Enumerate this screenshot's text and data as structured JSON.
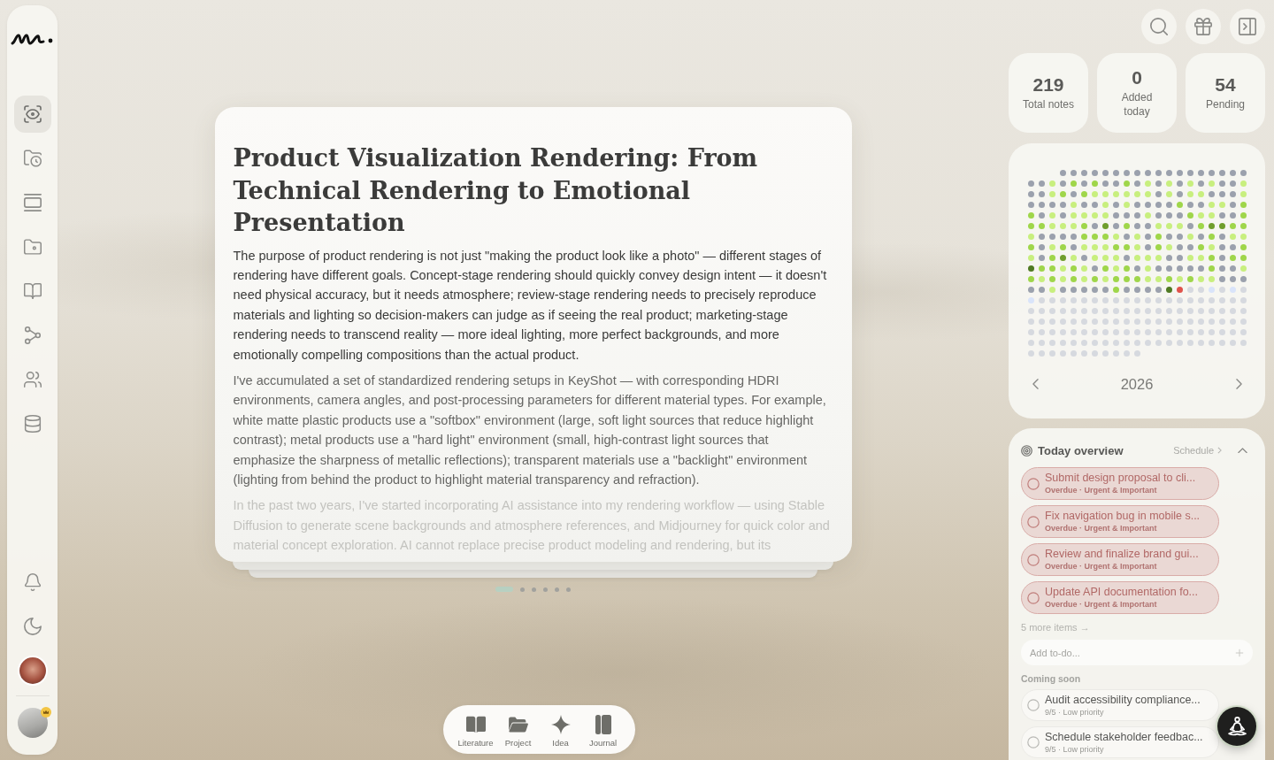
{
  "sidebar": {
    "nav": [
      {
        "selected": true
      },
      {
        "selected": false
      },
      {
        "selected": false
      },
      {
        "selected": false
      },
      {
        "selected": false
      },
      {
        "selected": false
      },
      {
        "selected": false
      },
      {
        "selected": false
      }
    ]
  },
  "article": {
    "title": "Product Visualization Rendering: From Technical Rendering to Emotional Presentation",
    "paragraphs": [
      "The purpose of product rendering is not just \"making the product look like a photo\" — different stages of rendering have different goals. Concept-stage rendering should quickly convey design intent — it doesn't need physical accuracy, but it needs atmosphere; review-stage rendering needs to precisely reproduce materials and lighting so decision-makers can judge as if seeing the real product; marketing-stage rendering needs to transcend reality — more ideal lighting, more perfect backgrounds, and more emotionally compelling compositions than the actual product.",
      "I've accumulated a set of standardized rendering setups in KeyShot — with corresponding HDRI environments, camera angles, and post-processing parameters for different material types. For example, white matte plastic products use a \"softbox\" environment (large, soft light sources that reduce highlight contrast); metal products use a \"hard light\" environment (small, high-contrast light sources that emphasize the sharpness of metallic reflections); transparent materials use a \"backlight\" environment (lighting from behind the product to highlight material transparency and refraction).",
      "In the past two years, I've started incorporating AI assistance into my rendering workflow — using Stable Diffusion to generate scene backgrounds and atmosphere references, and Midjourney for quick color and material concept exploration. AI cannot replace precise product modeling and rendering, but its"
    ]
  },
  "pager": [
    {
      "selected": true
    },
    {
      "selected": false
    },
    {
      "selected": false
    },
    {
      "selected": false
    },
    {
      "selected": false
    },
    {
      "selected": false
    }
  ],
  "toolbar": [
    {
      "label": "Literature"
    },
    {
      "label": "Project"
    },
    {
      "label": "Idea"
    },
    {
      "label": "Journal"
    }
  ],
  "stats": [
    {
      "value": "219",
      "label": "Total notes"
    },
    {
      "value": "0",
      "label": "Added today"
    },
    {
      "value": "54",
      "label": "Pending"
    }
  ],
  "calendar": {
    "days": [
      {
        "color": "#9ba1ad"
      },
      {
        "color": "#9ba1ad"
      },
      {
        "color": "#9ba1ad"
      },
      {
        "color": "#9ba1ad"
      },
      {
        "color": "#9ba1ad"
      },
      {
        "color": "#9ba1ad"
      },
      {
        "color": "#9ba1ad"
      },
      {
        "color": "#9ba1ad"
      },
      {
        "color": "#9ba1ad"
      },
      {
        "color": "#9ba1ad"
      },
      {
        "color": "#9ba1ad"
      },
      {
        "color": "#9ba1ad"
      },
      {
        "color": "#9ba1ad"
      },
      {
        "color": "#9ba1ad"
      },
      {
        "color": "#9ba1ad"
      },
      {
        "color": "#9ba1ad"
      },
      {
        "color": "#9ba1ad"
      },
      {
        "color": "#9ba1ad"
      },
      {
        "color": "#9ba1ad"
      },
      {
        "color": "#9ba1ad"
      },
      {
        "color": "#c8ef7e"
      },
      {
        "color": "#9ba1ad"
      },
      {
        "color": "#9fd64a"
      },
      {
        "color": "#9ba1ad"
      },
      {
        "color": "#9fd64a"
      },
      {
        "color": "#9ba1ad"
      },
      {
        "color": "#9ba1ad"
      },
      {
        "color": "#9fd64a"
      },
      {
        "color": "#9ba1ad"
      },
      {
        "color": "#c8ef7e"
      },
      {
        "color": "#9ba1ad"
      },
      {
        "color": "#c8ef7e"
      },
      {
        "color": "#9ba1ad"
      },
      {
        "color": "#c8ef7e"
      },
      {
        "color": "#9ba1ad"
      },
      {
        "color": "#c8ef7e"
      },
      {
        "color": "#9ba1ad"
      },
      {
        "color": "#9ba1ad"
      },
      {
        "color": "#c8ef7e"
      },
      {
        "color": "#9ba1ad"
      },
      {
        "color": "#9ba1ad"
      },
      {
        "color": "#c8ef7e"
      },
      {
        "color": "#9fd64a"
      },
      {
        "color": "#9ba1ad"
      },
      {
        "color": "#9fd64a"
      },
      {
        "color": "#c8ef7e"
      },
      {
        "color": "#c8ef7e"
      },
      {
        "color": "#c8ef7e"
      },
      {
        "color": "#c8ef7e"
      },
      {
        "color": "#c8ef7e"
      },
      {
        "color": "#c8ef7e"
      },
      {
        "color": "#9ba1ad"
      },
      {
        "color": "#c8ef7e"
      },
      {
        "color": "#9ba1ad"
      },
      {
        "color": "#c8ef7e"
      },
      {
        "color": "#c8ef7e"
      },
      {
        "color": "#9ba1ad"
      },
      {
        "color": "#9ba1ad"
      },
      {
        "color": "#9ba1ad"
      },
      {
        "color": "#c8ef7e"
      },
      {
        "color": "#9ba1ad"
      },
      {
        "color": "#9ba1ad"
      },
      {
        "color": "#9ba1ad"
      },
      {
        "color": "#9ba1ad"
      },
      {
        "color": "#c8ef7e"
      },
      {
        "color": "#9ba1ad"
      },
      {
        "color": "#9ba1ad"
      },
      {
        "color": "#c8ef7e"
      },
      {
        "color": "#9ba1ad"
      },
      {
        "color": "#c8ef7e"
      },
      {
        "color": "#9ba1ad"
      },
      {
        "color": "#9ba1ad"
      },
      {
        "color": "#9ba1ad"
      },
      {
        "color": "#9ba1ad"
      },
      {
        "color": "#9fd64a"
      },
      {
        "color": "#9ba1ad"
      },
      {
        "color": "#9ba1ad"
      },
      {
        "color": "#c8ef7e"
      },
      {
        "color": "#c8ef7e"
      },
      {
        "color": "#9ba1ad"
      },
      {
        "color": "#9fd64a"
      },
      {
        "color": "#9fd64a"
      },
      {
        "color": "#9ba1ad"
      },
      {
        "color": "#c8ef7e"
      },
      {
        "color": "#9ba1ad"
      },
      {
        "color": "#c8ef7e"
      },
      {
        "color": "#c8ef7e"
      },
      {
        "color": "#c8ef7e"
      },
      {
        "color": "#c8ef7e"
      },
      {
        "color": "#9ba1ad"
      },
      {
        "color": "#9ba1ad"
      },
      {
        "color": "#9ba1ad"
      },
      {
        "color": "#c8ef7e"
      },
      {
        "color": "#9ba1ad"
      },
      {
        "color": "#9ba1ad"
      },
      {
        "color": "#9ba1ad"
      },
      {
        "color": "#9fd64a"
      },
      {
        "color": "#c8ef7e"
      },
      {
        "color": "#c8ef7e"
      },
      {
        "color": "#9ba1ad"
      },
      {
        "color": "#9ba1ad"
      },
      {
        "color": "#9fd64a"
      },
      {
        "color": "#9fd64a"
      },
      {
        "color": "#9fd64a"
      },
      {
        "color": "#c8ef7e"
      },
      {
        "color": "#c8ef7e"
      },
      {
        "color": "#c8ef7e"
      },
      {
        "color": "#9fd64a"
      },
      {
        "color": "#9ba1ad"
      },
      {
        "color": "#6f9e2c"
      },
      {
        "color": "#9ba1ad"
      },
      {
        "color": "#9fd64a"
      },
      {
        "color": "#9ba1ad"
      },
      {
        "color": "#9ba1ad"
      },
      {
        "color": "#c8ef7e"
      },
      {
        "color": "#c8ef7e"
      },
      {
        "color": "#c8ef7e"
      },
      {
        "color": "#9ba1ad"
      },
      {
        "color": "#9fd64a"
      },
      {
        "color": "#6f9e2c"
      },
      {
        "color": "#6f9e2c"
      },
      {
        "color": "#9fd64a"
      },
      {
        "color": "#9fd64a"
      },
      {
        "color": "#c8ef7e"
      },
      {
        "color": "#9ba1ad"
      },
      {
        "color": "#9ba1ad"
      },
      {
        "color": "#9ba1ad"
      },
      {
        "color": "#9ba1ad"
      },
      {
        "color": "#9fd64a"
      },
      {
        "color": "#9fd64a"
      },
      {
        "color": "#9fd64a"
      },
      {
        "color": "#c8ef7e"
      },
      {
        "color": "#9ba1ad"
      },
      {
        "color": "#c8ef7e"
      },
      {
        "color": "#9ba1ad"
      },
      {
        "color": "#9fd64a"
      },
      {
        "color": "#9ba1ad"
      },
      {
        "color": "#9ba1ad"
      },
      {
        "color": "#c8ef7e"
      },
      {
        "color": "#9ba1ad"
      },
      {
        "color": "#9fd64a"
      },
      {
        "color": "#9ba1ad"
      },
      {
        "color": "#c8ef7e"
      },
      {
        "color": "#c8ef7e"
      },
      {
        "color": "#9fd64a"
      },
      {
        "color": "#9ba1ad"
      },
      {
        "color": "#c8ef7e"
      },
      {
        "color": "#9fd64a"
      },
      {
        "color": "#9ba1ad"
      },
      {
        "color": "#c8ef7e"
      },
      {
        "color": "#c8ef7e"
      },
      {
        "color": "#c8ef7e"
      },
      {
        "color": "#9fd64a"
      },
      {
        "color": "#9fd64a"
      },
      {
        "color": "#c8ef7e"
      },
      {
        "color": "#9ba1ad"
      },
      {
        "color": "#9fd64a"
      },
      {
        "color": "#c8ef7e"
      },
      {
        "color": "#9ba1ad"
      },
      {
        "color": "#9ba1ad"
      },
      {
        "color": "#9fd64a"
      },
      {
        "color": "#c8ef7e"
      },
      {
        "color": "#9ba1ad"
      },
      {
        "color": "#9ba1ad"
      },
      {
        "color": "#9fd64a"
      },
      {
        "color": "#c8ef7e"
      },
      {
        "color": "#9ba1ad"
      },
      {
        "color": "#9fd64a"
      },
      {
        "color": "#6f9e2c"
      },
      {
        "color": "#c8ef7e"
      },
      {
        "color": "#9ba1ad"
      },
      {
        "color": "#c8ef7e"
      },
      {
        "color": "#c8ef7e"
      },
      {
        "color": "#c8ef7e"
      },
      {
        "color": "#9ba1ad"
      },
      {
        "color": "#c8ef7e"
      },
      {
        "color": "#c8ef7e"
      },
      {
        "color": "#c8ef7e"
      },
      {
        "color": "#9ba1ad"
      },
      {
        "color": "#9ba1ad"
      },
      {
        "color": "#c8ef7e"
      },
      {
        "color": "#c8ef7e"
      },
      {
        "color": "#9fd64a"
      },
      {
        "color": "#9ba1ad"
      },
      {
        "color": "#9fd64a"
      },
      {
        "color": "#9fd64a"
      },
      {
        "color": "#4f7a22"
      },
      {
        "color": "#9fd64a"
      },
      {
        "color": "#9fd64a"
      },
      {
        "color": "#c8ef7e"
      },
      {
        "color": "#9fd64a"
      },
      {
        "color": "#c8ef7e"
      },
      {
        "color": "#9ba1ad"
      },
      {
        "color": "#9fd64a"
      },
      {
        "color": "#c8ef7e"
      },
      {
        "color": "#9fd64a"
      },
      {
        "color": "#9ba1ad"
      },
      {
        "color": "#c8ef7e"
      },
      {
        "color": "#9ba1ad"
      },
      {
        "color": "#9ba1ad"
      },
      {
        "color": "#9ba1ad"
      },
      {
        "color": "#9ba1ad"
      },
      {
        "color": "#9ba1ad"
      },
      {
        "color": "#9fd64a"
      },
      {
        "color": "#9ba1ad"
      },
      {
        "color": "#9ba1ad"
      },
      {
        "color": "#c8ef7e"
      },
      {
        "color": "#9fd64a"
      },
      {
        "color": "#c8ef7e"
      },
      {
        "color": "#9fd64a"
      },
      {
        "color": "#c8ef7e"
      },
      {
        "color": "#9fd64a"
      },
      {
        "color": "#c8ef7e"
      },
      {
        "color": "#9fd64a"
      },
      {
        "color": "#c8ef7e"
      },
      {
        "color": "#9fd64a"
      },
      {
        "color": "#9fd64a"
      },
      {
        "color": "#9fd64a"
      },
      {
        "color": "#c8ef7e"
      },
      {
        "color": "#c8ef7e"
      },
      {
        "color": "#9fd64a"
      },
      {
        "color": "#c8ef7e"
      },
      {
        "color": "#9fd64a"
      },
      {
        "color": "#c8ef7e"
      },
      {
        "color": "#c8ef7e"
      },
      {
        "color": "#9ba1ad"
      },
      {
        "color": "#9ba1ad"
      },
      {
        "color": "#9ba1ad"
      },
      {
        "color": "#9ba1ad"
      },
      {
        "color": "#9ba1ad"
      },
      {
        "color": "#c8ef7e"
      },
      {
        "color": "#9ba1ad"
      },
      {
        "color": "#9ba1ad"
      },
      {
        "color": "#9ba1ad"
      },
      {
        "color": "#9ba1ad"
      },
      {
        "color": "#9ba1ad"
      },
      {
        "color": "#9fd64a"
      },
      {
        "color": "#9ba1ad"
      },
      {
        "color": "#9ba1ad"
      },
      {
        "color": "#9ba1ad"
      },
      {
        "color": "#9ba1ad"
      },
      {
        "color": "#4f7a22"
      },
      {
        "color": "#e0524a"
      },
      {
        "color": "#d6d9df"
      },
      {
        "color": "#d6d9df"
      },
      {
        "color": "#d9e4fa"
      },
      {
        "color": "#d6d9df"
      },
      {
        "color": "#d9e4fa"
      },
      {
        "color": "#d6d9df"
      },
      {
        "color": "#d9e4fa"
      },
      {
        "color": "#d6d9df"
      },
      {
        "color": "#d6d9df"
      },
      {
        "color": "#d6d9df"
      },
      {
        "color": "#d6d9df"
      },
      {
        "color": "#d6d9df"
      },
      {
        "color": "#d6d9df"
      },
      {
        "color": "#d6d9df"
      },
      {
        "color": "#d6d9df"
      },
      {
        "color": "#d6d9df"
      },
      {
        "color": "#d6d9df"
      },
      {
        "color": "#d6d9df"
      },
      {
        "color": "#d6d9df"
      },
      {
        "color": "#d6d9df"
      },
      {
        "color": "#d6d9df"
      },
      {
        "color": "#d6d9df"
      },
      {
        "color": "#d6d9df"
      },
      {
        "color": "#d6d9df"
      },
      {
        "color": "#d6d9df"
      },
      {
        "color": "#d6d9df"
      },
      {
        "color": "#d6d9df"
      },
      {
        "color": "#d6d9df"
      },
      {
        "color": "#d6d9df"
      },
      {
        "color": "#d6d9df"
      },
      {
        "color": "#d6d9df"
      },
      {
        "color": "#d6d9df"
      },
      {
        "color": "#d6d9df"
      },
      {
        "color": "#d6d9df"
      },
      {
        "color": "#d6d9df"
      },
      {
        "color": "#d6d9df"
      },
      {
        "color": "#d6d9df"
      },
      {
        "color": "#d6d9df"
      },
      {
        "color": "#d6d9df"
      },
      {
        "color": "#d6d9df"
      },
      {
        "color": "#d6d9df"
      },
      {
        "color": "#d6d9df"
      },
      {
        "color": "#d6d9df"
      },
      {
        "color": "#d6d9df"
      },
      {
        "color": "#d6d9df"
      },
      {
        "color": "#d6d9df"
      },
      {
        "color": "#d6d9df"
      },
      {
        "color": "#d6d9df"
      },
      {
        "color": "#d6d9df"
      },
      {
        "color": "#d6d9df"
      },
      {
        "color": "#d6d9df"
      },
      {
        "color": "#d6d9df"
      },
      {
        "color": "#d6d9df"
      },
      {
        "color": "#d6d9df"
      },
      {
        "color": "#d6d9df"
      },
      {
        "color": "#d6d9df"
      },
      {
        "color": "#d6d9df"
      },
      {
        "color": "#d6d9df"
      },
      {
        "color": "#d6d9df"
      },
      {
        "color": "#d6d9df"
      },
      {
        "color": "#d6d9df"
      },
      {
        "color": "#d6d9df"
      },
      {
        "color": "#d6d9df"
      },
      {
        "color": "#d6d9df"
      },
      {
        "color": "#d6d9df"
      },
      {
        "color": "#d6d9df"
      },
      {
        "color": "#d6d9df"
      },
      {
        "color": "#d6d9df"
      },
      {
        "color": "#d6d9df"
      },
      {
        "color": "#d6d9df"
      },
      {
        "color": "#d6d9df"
      },
      {
        "color": "#d6d9df"
      },
      {
        "color": "#d6d9df"
      },
      {
        "color": "#d6d9df"
      },
      {
        "color": "#d6d9df"
      },
      {
        "color": "#d6d9df"
      },
      {
        "color": "#d6d9df"
      },
      {
        "color": "#d6d9df"
      },
      {
        "color": "#d6d9df"
      },
      {
        "color": "#d6d9df"
      },
      {
        "color": "#d6d9df"
      },
      {
        "color": "#d6d9df"
      },
      {
        "color": "#d6d9df"
      },
      {
        "color": "#d6d9df"
      },
      {
        "color": "#d6d9df"
      },
      {
        "color": "#d6d9df"
      },
      {
        "color": "#d6d9df"
      },
      {
        "color": "#d6d9df"
      },
      {
        "color": "#d6d9df"
      },
      {
        "color": "#d6d9df"
      },
      {
        "color": "#d6d9df"
      },
      {
        "color": "#d6d9df"
      },
      {
        "color": "#d6d9df"
      },
      {
        "color": "#d6d9df"
      },
      {
        "color": "#d6d9df"
      },
      {
        "color": "#d6d9df"
      },
      {
        "color": "#d6d9df"
      },
      {
        "color": "#d6d9df"
      },
      {
        "color": "#d6d9df"
      },
      {
        "color": "#d6d9df"
      },
      {
        "color": "#d6d9df"
      },
      {
        "color": "#d6d9df"
      },
      {
        "color": "#d6d9df"
      },
      {
        "color": "#d6d9df"
      },
      {
        "color": "#d6d9df"
      },
      {
        "color": "#d6d9df"
      },
      {
        "color": "#d6d9df"
      },
      {
        "color": "#d6d9df"
      },
      {
        "color": "#d6d9df"
      },
      {
        "color": "#d6d9df"
      },
      {
        "color": "#d6d9df"
      },
      {
        "color": "#d6d9df"
      },
      {
        "color": "#d6d9df"
      },
      {
        "color": "#d6d9df"
      },
      {
        "color": "#d6d9df"
      },
      {
        "color": "#d6d9df"
      },
      {
        "color": "#d6d9df"
      },
      {
        "color": "#d6d9df"
      },
      {
        "color": "#d6d9df"
      },
      {
        "color": "#d6d9df"
      },
      {
        "color": "#d6d9df"
      },
      {
        "color": "#d6d9df"
      }
    ],
    "year": "2026"
  },
  "overview": {
    "title": "Today overview",
    "schedule_link": "Schedule",
    "overdue": [
      {
        "title": "Submit design proposal to cli...",
        "meta": "Overdue · Urgent & Important",
        "checked": false
      },
      {
        "title": "Fix navigation bug in mobile s...",
        "meta": "Overdue · Urgent & Important",
        "checked": false
      },
      {
        "title": "Review and finalize brand gui...",
        "meta": "Overdue · Urgent & Important",
        "checked": false
      },
      {
        "title": "Update API documentation fo...",
        "meta": "Overdue · Urgent & Important",
        "checked": false
      }
    ],
    "more_link": "5 more items →",
    "add_todo": {
      "placeholder": "Add to-do..."
    },
    "coming_soon_label": "Coming soon",
    "coming_soon": [
      {
        "title": "Audit accessibility compliance...",
        "meta": "9/5 · Low priority",
        "checked": false
      },
      {
        "title": "Schedule stakeholder feedbac...",
        "meta": "9/5 · Low priority",
        "checked": false
      }
    ]
  }
}
